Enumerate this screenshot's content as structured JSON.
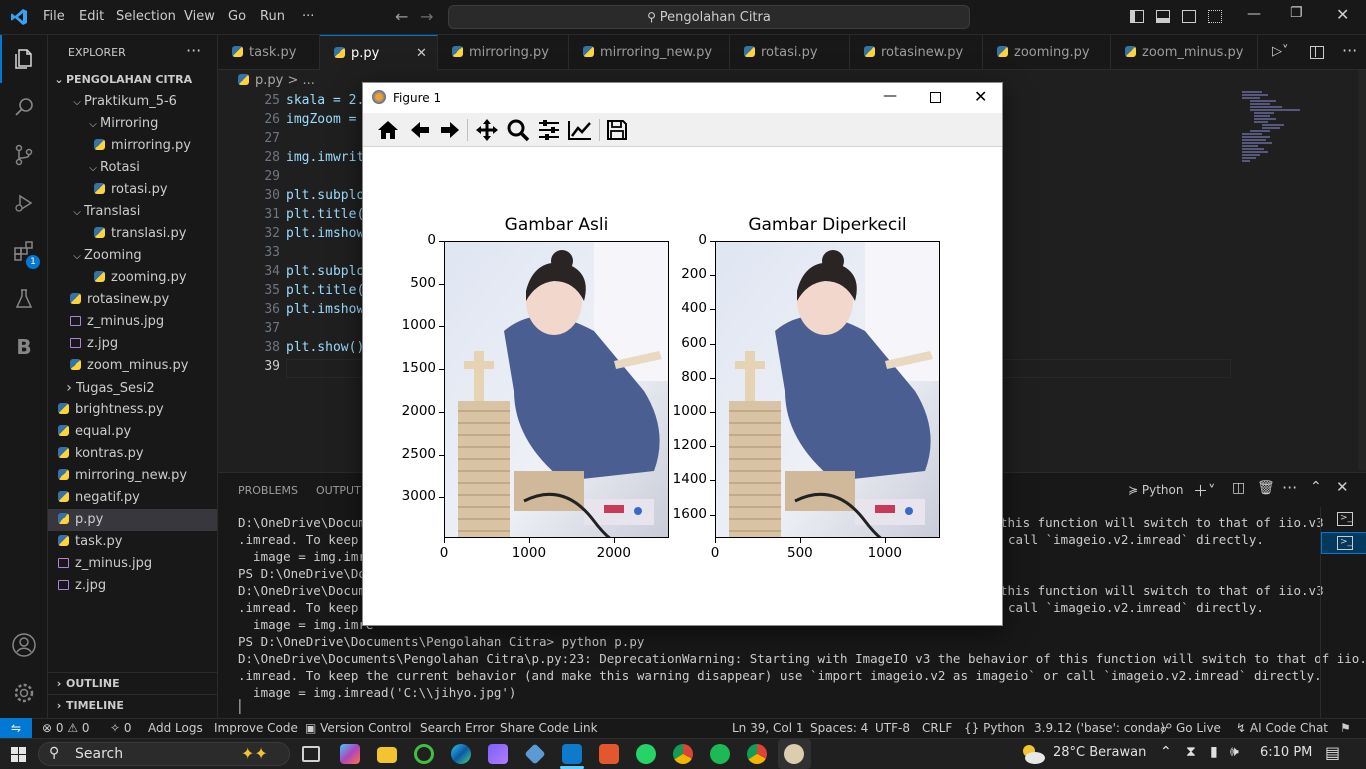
{
  "menu": [
    "File",
    "Edit",
    "Selection",
    "View",
    "Go",
    "Run",
    "···"
  ],
  "search": {
    "text": "Pengolahan Citra"
  },
  "explorer": {
    "title": "EXPLORER",
    "root": "PENGOLAHAN CITRA",
    "items": [
      {
        "label": "Praktikum_5-6",
        "type": "folder-open"
      },
      {
        "label": "Mirroring",
        "type": "folder-open"
      },
      {
        "label": "mirroring.py",
        "type": "py"
      },
      {
        "label": "Rotasi",
        "type": "folder-open"
      },
      {
        "label": "rotasi.py",
        "type": "py"
      },
      {
        "label": "Translasi",
        "type": "folder-open"
      },
      {
        "label": "translasi.py",
        "type": "py"
      },
      {
        "label": "Zooming",
        "type": "folder-open"
      },
      {
        "label": "zooming.py",
        "type": "py"
      },
      {
        "label": "rotasinew.py",
        "type": "py"
      },
      {
        "label": "z_minus.jpg",
        "type": "jpg"
      },
      {
        "label": "z.jpg",
        "type": "jpg"
      },
      {
        "label": "zoom_minus.py",
        "type": "py"
      },
      {
        "label": "Tugas_Sesi2",
        "type": "folder-closed"
      },
      {
        "label": "brightness.py",
        "type": "py"
      },
      {
        "label": "equal.py",
        "type": "py"
      },
      {
        "label": "kontras.py",
        "type": "py"
      },
      {
        "label": "mirroring_new.py",
        "type": "py"
      },
      {
        "label": "negatif.py",
        "type": "py"
      },
      {
        "label": "p.py",
        "type": "py"
      },
      {
        "label": "task.py",
        "type": "py"
      },
      {
        "label": "z_minus.jpg",
        "type": "jpg"
      },
      {
        "label": "z.jpg",
        "type": "jpg"
      }
    ],
    "outline": "OUTLINE",
    "timeline": "TIMELINE"
  },
  "tabs": [
    "task.py",
    "p.py",
    "mirroring.py",
    "mirroring_new.py",
    "rotasi.py",
    "rotasinew.py",
    "zooming.py",
    "zoom_minus.py"
  ],
  "breadcrumb": "p.py > ...",
  "editor": {
    "lines": [
      {
        "n": "25",
        "code": "skala = 2."
      },
      {
        "n": "26",
        "code": "imgZoom ="
      },
      {
        "n": "27",
        "code": ""
      },
      {
        "n": "28",
        "code": "img.imwrit"
      },
      {
        "n": "29",
        "code": ""
      },
      {
        "n": "30",
        "code": "plt.subplo"
      },
      {
        "n": "31",
        "code": "plt.title("
      },
      {
        "n": "32",
        "code": "plt.imshow"
      },
      {
        "n": "33",
        "code": ""
      },
      {
        "n": "34",
        "code": "plt.subplo"
      },
      {
        "n": "35",
        "code": "plt.title("
      },
      {
        "n": "36",
        "code": "plt.imshow"
      },
      {
        "n": "37",
        "code": ""
      },
      {
        "n": "38",
        "code": "plt.show()"
      },
      {
        "n": "39",
        "code": ""
      }
    ]
  },
  "panel": {
    "tabs": [
      "PROBLEMS",
      "OUTPUT"
    ],
    "shell": "Python",
    "lines": [
      "D:\\OneDrive\\Docume",
      ".imread. To keep t",
      "  image = img.imre",
      "PS D:\\OneDrive\\Doc",
      "D:\\OneDrive\\Docume",
      ".imread. To keep t",
      "  image = img.imre",
      "PS D:\\OneDrive\\Documents\\Pengolahan Citra> python p.py",
      "D:\\OneDrive\\Documents\\Pengolahan Citra\\p.py:23: DeprecationWarning: Starting with ImageIO v3 the behavior of this function will switch to that of iio.v3",
      ".imread. To keep the current behavior (and make this warning disappear) use `import imageio.v2 as imageio` or call `imageio.v2.imread` directly.",
      "  image = img.imread('C:\\\\jihyo.jpg')"
    ],
    "right_fragments": [
      "this function will switch to that of iio.v3",
      "call `imageio.v2.imread` directly.",
      "this function will switch to that of iio.v3",
      "call `imageio.v2.imread` directly."
    ],
    "cursor": "│"
  },
  "statusbar": {
    "errors": "0",
    "warnings": "0",
    "ports": "0",
    "add_logs": "Add Logs",
    "improve_code": "Improve Code",
    "version_control": "Version Control",
    "search_error": "Search Error",
    "share_code_link": "Share Code Link",
    "position": "Ln 39, Col 1",
    "spaces": "Spaces: 4",
    "encoding": "UTF-8",
    "eol": "CRLF",
    "language": "Python",
    "interpreter": "3.9.12 ('base': conda)",
    "go_live": "Go Live",
    "ai_chat": "AI Code Chat"
  },
  "figure": {
    "title": "Figure 1",
    "plots": [
      {
        "title": "Gambar Asli",
        "yticks": [
          "0",
          "500",
          "1000",
          "1500",
          "2000",
          "2500",
          "3000"
        ],
        "xticks": [
          "0",
          "1000",
          "2000"
        ]
      },
      {
        "title": "Gambar Diperkecil",
        "yticks": [
          "0",
          "200",
          "400",
          "600",
          "800",
          "1000",
          "1200",
          "1400",
          "1600"
        ],
        "xticks": [
          "0",
          "500",
          "1000"
        ]
      }
    ]
  },
  "taskbar": {
    "search": "Search",
    "weather": "28°C  Berawan",
    "time": "6:10 PM"
  },
  "colors": {
    "accent": "#0078d4",
    "bg": "#1f1f1f",
    "sidebar": "#181818",
    "keyword": "#9cdcfe",
    "function": "#dcdcaa"
  }
}
